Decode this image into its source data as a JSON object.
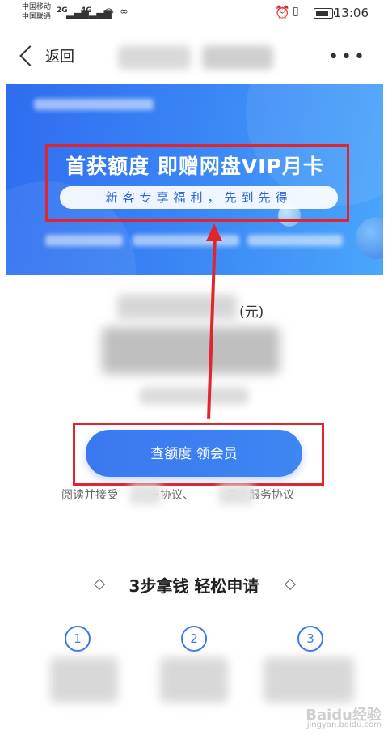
{
  "status_bar": {
    "carrier1": "中国移动",
    "carrier2": "中国联通",
    "net1": "2G",
    "net2": "4G",
    "time": "13:06"
  },
  "nav": {
    "back_label": "返回",
    "more_label": "•••"
  },
  "banner": {
    "title": "首获额度 即赠网盘VIP月卡",
    "subtitle": "新客专享福利，先到先得"
  },
  "amount": {
    "unit": "(元)"
  },
  "cta": {
    "label": "查额度 领会员"
  },
  "agreement": {
    "prefix": "阅读并接受",
    "part1": "户协议、",
    "part2": "用户服务协议"
  },
  "steps": {
    "title": "3步拿钱 轻松申请",
    "items": [
      {
        "number": "1"
      },
      {
        "number": "2"
      },
      {
        "number": "3"
      }
    ]
  },
  "watermark": {
    "text": "Baidu经验",
    "url": "jingyan.baidu.com"
  },
  "colors": {
    "accent": "#3b78ef",
    "annotation": "#e0262c"
  }
}
